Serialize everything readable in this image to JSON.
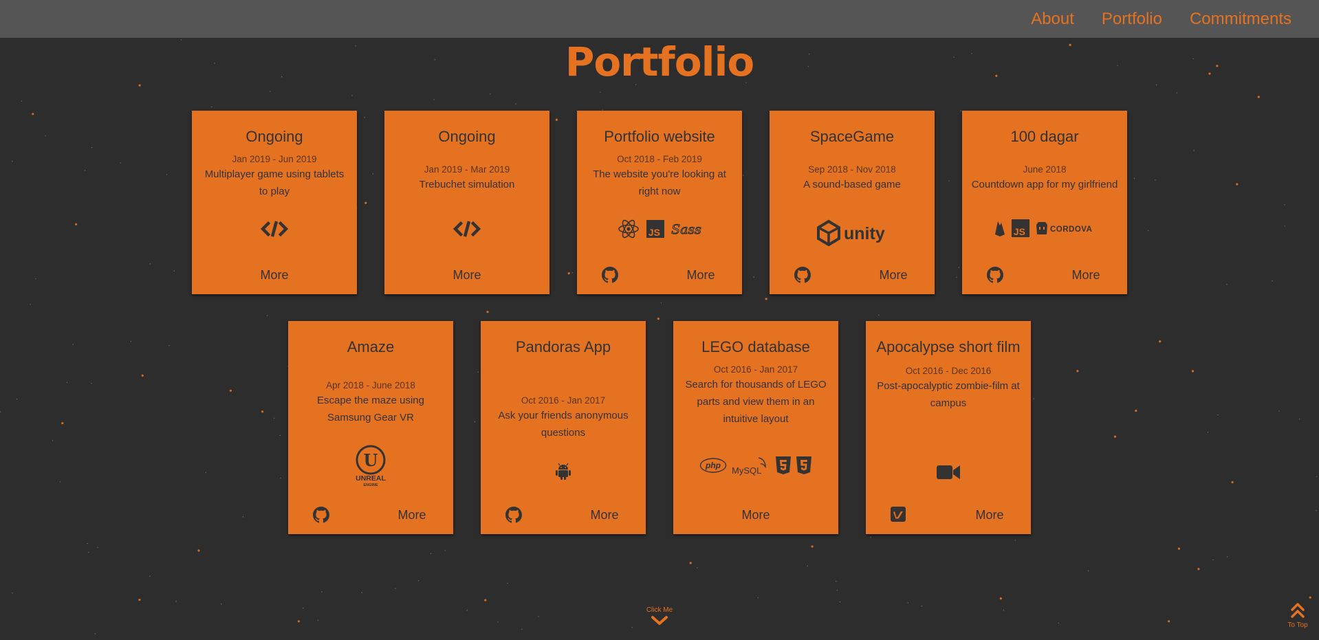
{
  "nav": {
    "items": [
      "About",
      "Portfolio",
      "Commitments"
    ]
  },
  "page": {
    "title": "Portfolio"
  },
  "cards": [
    {
      "title": "Ongoing",
      "date": "Jan 2019 - Jun 2019",
      "desc": "Multiplayer game using tablets to play",
      "icons": [
        "code-icon"
      ],
      "link_icon": null,
      "more": "More"
    },
    {
      "title": "Ongoing",
      "date": "Jan 2019 - Mar 2019",
      "desc": "Trebuchet simulation",
      "icons": [
        "code-icon"
      ],
      "link_icon": null,
      "more": "More"
    },
    {
      "title": "Portfolio website",
      "date": "Oct 2018 - Feb 2019",
      "desc": "The website you're looking at right now",
      "icons": [
        "react-icon",
        "javascript-icon",
        "sass-icon"
      ],
      "link_icon": "github-icon",
      "more": "More"
    },
    {
      "title": "SpaceGame",
      "date": "Sep 2018 - Nov 2018",
      "desc": "A sound-based game",
      "icons": [
        "unity-logo"
      ],
      "link_icon": "github-icon",
      "more": "More"
    },
    {
      "title": "100 dagar",
      "date": "June 2018",
      "desc": "Countdown app for my girlfriend",
      "icons": [
        "firebase-icon",
        "javascript-icon",
        "cordova-logo"
      ],
      "link_icon": "github-icon",
      "more": "More"
    },
    {
      "title": "Amaze",
      "date": "Apr 2018 - June 2018",
      "desc": "Escape the maze using Samsung Gear VR",
      "icons": [
        "unreal-engine-logo"
      ],
      "link_icon": "github-icon",
      "more": "More"
    },
    {
      "title": "Pandoras App",
      "date": "Oct 2016 - Jan 2017",
      "desc": "Ask your friends anonymous questions",
      "icons": [
        "android-icon"
      ],
      "link_icon": "github-icon",
      "more": "More"
    },
    {
      "title": "LEGO database",
      "date": "Oct 2016 - Jan 2017",
      "desc": "Search for thousands of LEGO parts and view them in an intuitive layout",
      "icons": [
        "php-logo",
        "mysql-logo",
        "html5-icon",
        "css3-icon"
      ],
      "link_icon": null,
      "more": "More"
    },
    {
      "title": "Apocalypse short film",
      "date": "Oct 2016 - Dec 2016",
      "desc": "Post-apocalyptic zombie-film at campus",
      "icons": [
        "video-camera-icon"
      ],
      "link_icon": "vimeo-icon",
      "more": "More"
    }
  ],
  "logo_text": {
    "unity": "unity",
    "cordova": "CORDOVA",
    "unreal": "UNREAL",
    "unreal_sub": "ENGINE",
    "php": "php",
    "mysql": "MySQL",
    "js": "JS",
    "sass": "Sass"
  },
  "footer": {
    "click_me": "Click Me",
    "to_top": "To Top"
  },
  "colors": {
    "accent": "#e57220",
    "background": "#2d2d2d",
    "navbar": "#555555",
    "card_text": "#333333"
  }
}
